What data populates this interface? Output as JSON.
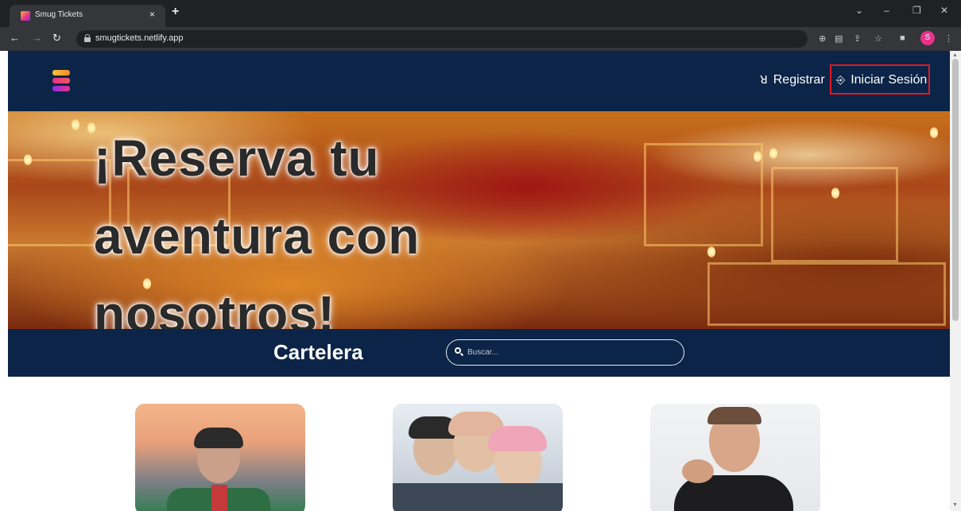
{
  "browser": {
    "tab_title": "Smug Tickets",
    "tab_close": "×",
    "new_tab": "+",
    "url": "smugtickets.netlify.app",
    "profile_initial": "S",
    "window_controls": [
      "⌄",
      "–",
      "❐",
      "✕"
    ]
  },
  "header": {
    "register_label": "Registrar",
    "login_label": "Iniciar Sesión"
  },
  "hero": {
    "title": "¡Reserva tu aventura con nosotros!"
  },
  "cartelera": {
    "title": "Cartelera",
    "search_placeholder": "Buscar..."
  },
  "cards": [
    {
      "name": "event-card-1"
    },
    {
      "name": "event-card-2"
    },
    {
      "name": "event-card-3"
    }
  ],
  "colors": {
    "navy": "#0b2447",
    "highlight_border": "#e01b24"
  }
}
